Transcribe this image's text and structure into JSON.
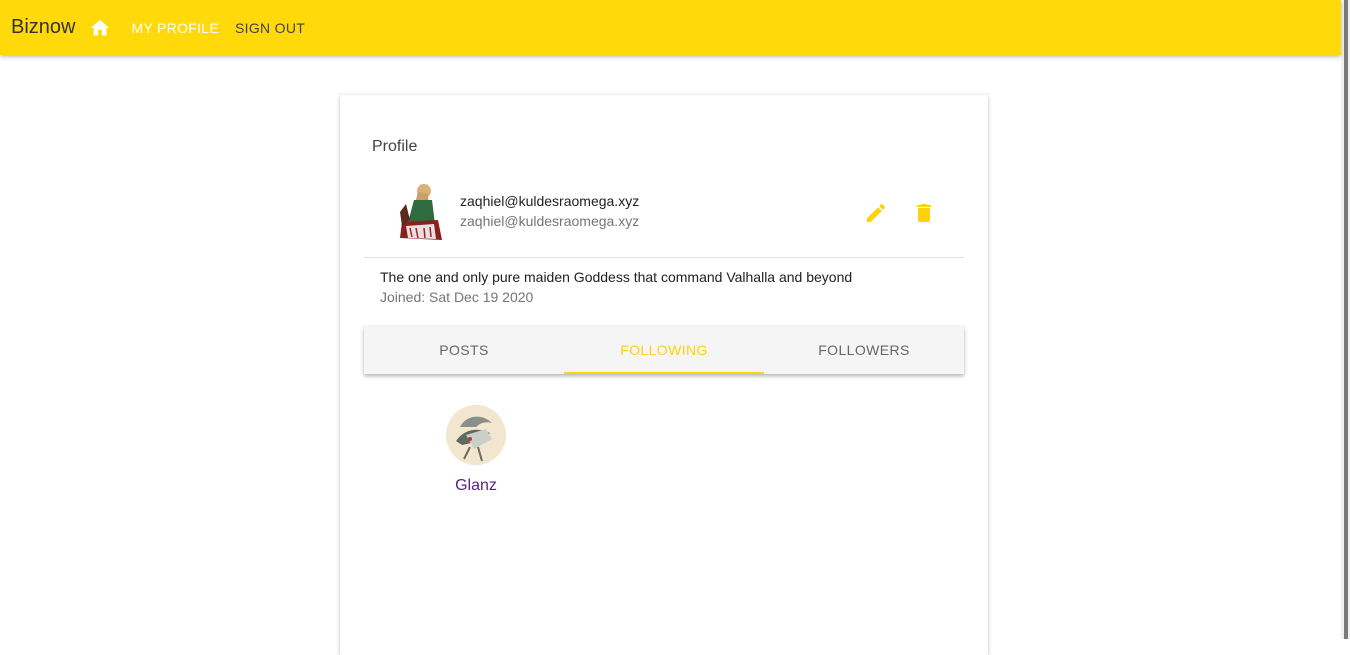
{
  "header": {
    "brand": "Biznow",
    "nav": {
      "my_profile": "MY PROFILE",
      "sign_out": "SIGN OUT"
    },
    "accent_color": "#ffd90a"
  },
  "profile": {
    "title": "Profile",
    "email": "zaqhiel@kuldesraomega.xyz",
    "username": "zaqhiel@kuldesraomega.xyz",
    "bio": "The one and only pure maiden Goddess that command Valhalla and beyond",
    "joined": "Joined: Sat Dec 19 2020",
    "actions": [
      "edit-icon",
      "delete-icon"
    ]
  },
  "tabs": [
    {
      "label": "POSTS",
      "active": false
    },
    {
      "label": "FOLLOWING",
      "active": true
    },
    {
      "label": "FOLLOWERS",
      "active": false
    }
  ],
  "following": [
    {
      "name": "Glanz"
    }
  ]
}
